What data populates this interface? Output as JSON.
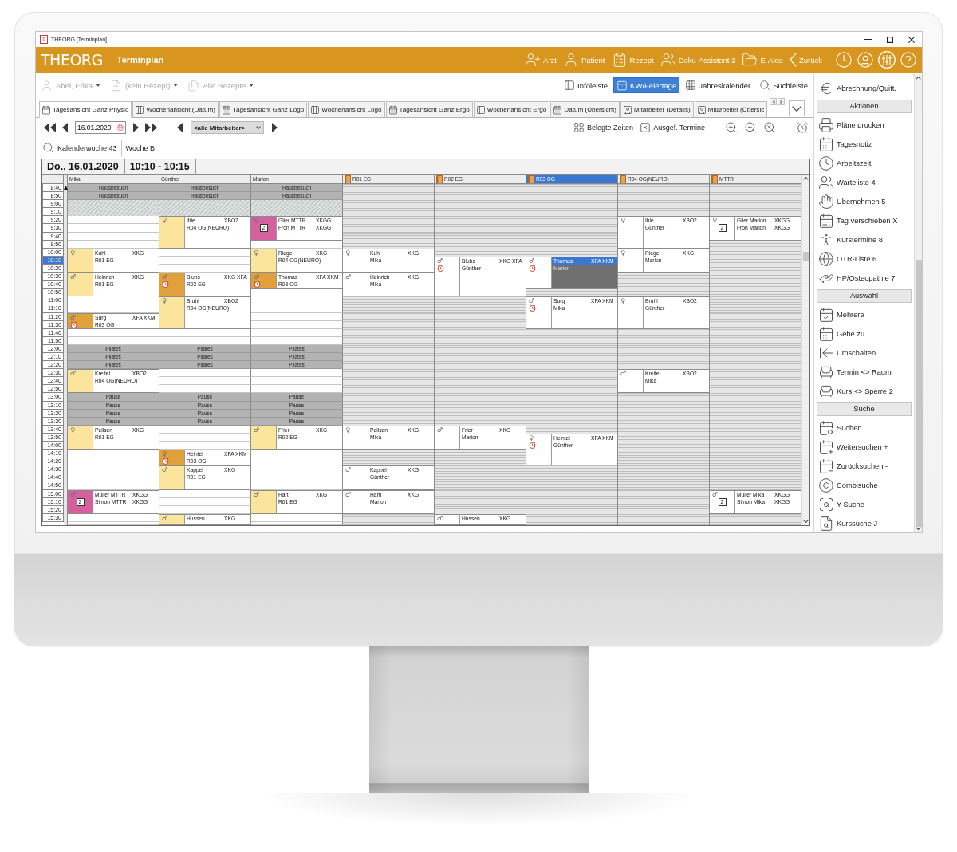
{
  "window": {
    "icon_letter": "T",
    "title": "THEORG [Terminplan]"
  },
  "header": {
    "logo": "THEORG",
    "title": "Terminplan",
    "nav": [
      {
        "label": "Arzt"
      },
      {
        "label": "Patient"
      },
      {
        "label": "Rezept"
      },
      {
        "label": "Doku-Assistent 3"
      },
      {
        "label": "E-Akte"
      },
      {
        "label": "Zurück"
      }
    ]
  },
  "toolbar": {
    "selectors": [
      {
        "label": "Abel, Erika",
        "disabled": true
      },
      {
        "label": "(kein Rezept)",
        "disabled": true
      },
      {
        "label": "Alle Rezepte",
        "disabled": true
      }
    ],
    "toggles": [
      {
        "label": "Infoleiste",
        "selected": false
      },
      {
        "label": "KW/Feiertage",
        "selected": true
      },
      {
        "label": "Jahreskalender",
        "selected": false
      },
      {
        "label": "Suchleiste",
        "selected": false
      }
    ]
  },
  "tabs": [
    {
      "label": "Tagesansicht Ganz Physio",
      "selected": true
    },
    {
      "label": "Wochenansicht (Datum)",
      "selected": false
    },
    {
      "label": "Tagesansicht Ganz Logo",
      "selected": false
    },
    {
      "label": "Wochenansicht Logo",
      "selected": false
    },
    {
      "label": "Tagesansicht Ganz Ergo",
      "selected": false
    },
    {
      "label": "Wochenansicht Ergo",
      "selected": false
    },
    {
      "label": "Datum (Übersicht)",
      "selected": false
    },
    {
      "label": "Mitarbeiter (Details)",
      "selected": false
    },
    {
      "label": "Mitarbeiter (Übersic",
      "selected": false
    }
  ],
  "navigation": {
    "date": "16.01.2020",
    "filter": "<alle Mitarbeiter>",
    "actions": [
      {
        "label": "Belegte Zeiten"
      },
      {
        "label": "Ausgef. Termine"
      }
    ]
  },
  "week_bar": {
    "week": "Kalenderwoche 43",
    "rotation": "Woche B"
  },
  "calendar": {
    "date": "Do., 16.01.2020",
    "time": "10:10 - 10:15",
    "time_slots": [
      {
        "label": "8:40",
        "selected": false
      },
      {
        "label": "8:50",
        "selected": false
      },
      {
        "label": "9:00",
        "selected": false
      },
      {
        "label": "9:10",
        "selected": false
      },
      {
        "label": "9:20",
        "selected": false
      },
      {
        "label": "9:30",
        "selected": false
      },
      {
        "label": "9:40",
        "selected": false
      },
      {
        "label": "9:50",
        "selected": false
      },
      {
        "label": "10:00",
        "selected": false
      },
      {
        "label": "10:10",
        "selected": true
      },
      {
        "label": "10:20",
        "selected": false
      },
      {
        "label": "10:30",
        "selected": false
      },
      {
        "label": "10:40",
        "selected": false
      },
      {
        "label": "10:50",
        "selected": false
      },
      {
        "label": "11:00",
        "selected": false
      },
      {
        "label": "11:10",
        "selected": false
      },
      {
        "label": "11:20",
        "selected": false
      },
      {
        "label": "11:30",
        "selected": false
      },
      {
        "label": "11:40",
        "selected": false
      },
      {
        "label": "11:50",
        "selected": false
      },
      {
        "label": "12:00",
        "selected": false
      },
      {
        "label": "12:10",
        "selected": false
      },
      {
        "label": "12:20",
        "selected": false
      },
      {
        "label": "12:30",
        "selected": false
      },
      {
        "label": "12:40",
        "selected": false
      },
      {
        "label": "12:50",
        "selected": false
      },
      {
        "label": "13:00",
        "selected": false
      },
      {
        "label": "13:10",
        "selected": false
      },
      {
        "label": "13:20",
        "selected": false
      },
      {
        "label": "13:30",
        "selected": false
      },
      {
        "label": "13:40",
        "selected": false
      },
      {
        "label": "13:50",
        "selected": false
      },
      {
        "label": "14:00",
        "selected": false
      },
      {
        "label": "14:10",
        "selected": false
      },
      {
        "label": "14:20",
        "selected": false
      },
      {
        "label": "14:30",
        "selected": false
      },
      {
        "label": "14:40",
        "selected": false
      },
      {
        "label": "14:50",
        "selected": false
      },
      {
        "label": "15:00",
        "selected": false
      },
      {
        "label": "15:10",
        "selected": false
      },
      {
        "label": "15:20",
        "selected": false
      },
      {
        "label": "15:30",
        "selected": false
      }
    ],
    "columns": [
      {
        "kind": "employee",
        "header": "Mika",
        "selected": false,
        "slots": [
          {
            "kind": "block",
            "label": "Hausbesuch"
          },
          {
            "kind": "block",
            "label": "Hausbesuch"
          },
          {
            "kind": "hatch"
          },
          {
            "kind": "hatch"
          },
          {
            "kind": "free"
          },
          {
            "kind": "free"
          },
          {
            "kind": "free"
          },
          {
            "kind": "free"
          },
          {
            "kind": "appointment",
            "symbol": "♀",
            "color": "#fbe49c",
            "clock": false,
            "selected": false,
            "lines": [
              {
                "name": "Kuhl",
                "code": "XKG"
              },
              {
                "name": "R01 EG"
              }
            ]
          },
          {
            "kind": "continued"
          },
          {
            "kind": "continued"
          },
          {
            "kind": "appointment",
            "symbol": "♂",
            "color": "#fbe49c",
            "clock": false,
            "selected": false,
            "lines": [
              {
                "name": "Heinrich",
                "code": "XKG"
              },
              {
                "name": "R01 EG"
              }
            ]
          },
          {
            "kind": "continued"
          },
          {
            "kind": "continued"
          },
          {
            "kind": "free"
          },
          {
            "kind": "free"
          },
          {
            "kind": "appointment",
            "symbol": "♂",
            "color": "#e0a03c",
            "clock": true,
            "selected": false,
            "lines": [
              {
                "name": "Surg",
                "code": "XFA XKM"
              },
              {
                "name": "R03 OG"
              }
            ]
          },
          {
            "kind": "continued"
          },
          {
            "kind": "free"
          },
          {
            "kind": "free"
          },
          {
            "kind": "block",
            "label": "Pilates"
          },
          {
            "kind": "block",
            "label": "Pilates"
          },
          {
            "kind": "block",
            "label": "Pilates"
          },
          {
            "kind": "appointment",
            "symbol": "♂",
            "color": "#fbe49c",
            "clock": false,
            "selected": false,
            "lines": [
              {
                "name": "Kreitel",
                "code": "XBO2"
              },
              {
                "name": "R04 OG(NEURO)"
              }
            ]
          },
          {
            "kind": "continued"
          },
          {
            "kind": "continued"
          },
          {
            "kind": "block",
            "label": "Pause"
          },
          {
            "kind": "block",
            "label": "Pause"
          },
          {
            "kind": "block",
            "label": "Pause"
          },
          {
            "kind": "block",
            "label": "Pause"
          },
          {
            "kind": "appointment",
            "symbol": "♀",
            "color": "#fbe49c",
            "clock": false,
            "selected": false,
            "lines": [
              {
                "name": "Peilsen",
                "code": "XKG"
              },
              {
                "name": "R01 EG"
              }
            ]
          },
          {
            "kind": "continued"
          },
          {
            "kind": "continued"
          },
          {
            "kind": "free"
          },
          {
            "kind": "free"
          },
          {
            "kind": "free"
          },
          {
            "kind": "free"
          },
          {
            "kind": "free"
          },
          {
            "kind": "appointment",
            "symbol": "♂",
            "color": "#d5609e",
            "clock": false,
            "count": "2",
            "selected": false,
            "lines": [
              {
                "name": "Müller MTTR",
                "code": "XKGG"
              },
              {
                "name": "Simon MTTR",
                "code": "XKGG"
              }
            ]
          },
          {
            "kind": "continued"
          },
          {
            "kind": "continued"
          },
          {
            "kind": "free"
          },
          {
            "kind": "free"
          }
        ]
      },
      {
        "kind": "employee",
        "header": "Günther",
        "selected": false,
        "slots": [
          {
            "kind": "block",
            "label": "Hausbesuch"
          },
          {
            "kind": "block",
            "label": "Hausbesuch"
          },
          {
            "kind": "hatch"
          },
          {
            "kind": "hatch"
          },
          {
            "kind": "appointment",
            "symbol": "♀",
            "color": "#fbe49c",
            "clock": false,
            "selected": false,
            "lines": [
              {
                "name": "Ihle",
                "code": "XBO2"
              },
              {
                "name": "R04 OG(NEURO)"
              }
            ]
          },
          {
            "kind": "continued"
          },
          {
            "kind": "continued"
          },
          {
            "kind": "continued"
          },
          {
            "kind": "free"
          },
          {
            "kind": "free"
          },
          {
            "kind": "free"
          },
          {
            "kind": "appointment",
            "symbol": "♂",
            "color": "#e0a03c",
            "clock": true,
            "selected": false,
            "lines": [
              {
                "name": "Bluhs",
                "code": "XKG XFA"
              },
              {
                "name": "R02 EG"
              }
            ]
          },
          {
            "kind": "continued"
          },
          {
            "kind": "continued"
          },
          {
            "kind": "appointment",
            "symbol": "♀",
            "color": "#fbe49c",
            "clock": false,
            "selected": false,
            "lines": [
              {
                "name": "Bruhl",
                "code": "XBO2"
              },
              {
                "name": "R04 OG(NEURO)"
              }
            ]
          },
          {
            "kind": "continued"
          },
          {
            "kind": "continued"
          },
          {
            "kind": "continued"
          },
          {
            "kind": "free"
          },
          {
            "kind": "free"
          },
          {
            "kind": "block",
            "label": "Pilates"
          },
          {
            "kind": "block",
            "label": "Pilates"
          },
          {
            "kind": "block",
            "label": "Pilates"
          },
          {
            "kind": "free"
          },
          {
            "kind": "free"
          },
          {
            "kind": "free"
          },
          {
            "kind": "block",
            "label": "Pause"
          },
          {
            "kind": "block",
            "label": "Pause"
          },
          {
            "kind": "block",
            "label": "Pause"
          },
          {
            "kind": "block",
            "label": "Pause"
          },
          {
            "kind": "free"
          },
          {
            "kind": "free"
          },
          {
            "kind": "free"
          },
          {
            "kind": "appointment",
            "symbol": "♀",
            "color": "#e0a03c",
            "clock": true,
            "selected": false,
            "lines": [
              {
                "name": "Heintel",
                "code": "XFA XKM"
              },
              {
                "name": "R03 OG"
              }
            ]
          },
          {
            "kind": "continued"
          },
          {
            "kind": "appointment",
            "symbol": "♂",
            "color": "#fbe49c",
            "clock": false,
            "selected": false,
            "lines": [
              {
                "name": "Kappel",
                "code": "XKG"
              },
              {
                "name": "R01 EG"
              }
            ]
          },
          {
            "kind": "continued"
          },
          {
            "kind": "continued"
          },
          {
            "kind": "free"
          },
          {
            "kind": "free"
          },
          {
            "kind": "free"
          },
          {
            "kind": "appointment",
            "symbol": "♂",
            "color": "#fbe49c",
            "clock": false,
            "selected": false,
            "lines": [
              {
                "name": "Hussen",
                "code": "XKG"
              }
            ]
          },
          {
            "kind": "continued"
          }
        ]
      },
      {
        "kind": "employee",
        "header": "Marion",
        "selected": false,
        "slots": [
          {
            "kind": "block",
            "label": "Hausbesuch"
          },
          {
            "kind": "block",
            "label": "Hausbesuch"
          },
          {
            "kind": "hatch"
          },
          {
            "kind": "hatch"
          },
          {
            "kind": "appointment",
            "symbol": "♀",
            "color": "#d5609e",
            "clock": false,
            "count": "2",
            "selected": false,
            "lines": [
              {
                "name": "Glier MTTR",
                "code": "XKGG"
              },
              {
                "name": "Froh MTTR",
                "code": "XKGG"
              }
            ]
          },
          {
            "kind": "continued"
          },
          {
            "kind": "continued"
          },
          {
            "kind": "free"
          },
          {
            "kind": "appointment",
            "symbol": "♀",
            "color": "#fbe49c",
            "clock": false,
            "selected": false,
            "lines": [
              {
                "name": "Riegel",
                "code": "XKG"
              },
              {
                "name": "R04 OG(NEURO)"
              }
            ]
          },
          {
            "kind": "continued"
          },
          {
            "kind": "continued"
          },
          {
            "kind": "appointment",
            "symbol": "♂",
            "color": "#e0a03c",
            "clock": true,
            "selected": false,
            "lines": [
              {
                "name": "Thomas",
                "code": "XFA XKM"
              },
              {
                "name": "R03 OG"
              }
            ]
          },
          {
            "kind": "continued"
          },
          {
            "kind": "free"
          },
          {
            "kind": "free"
          },
          {
            "kind": "free"
          },
          {
            "kind": "free"
          },
          {
            "kind": "free"
          },
          {
            "kind": "free"
          },
          {
            "kind": "free"
          },
          {
            "kind": "block",
            "label": "Pilates"
          },
          {
            "kind": "block",
            "label": "Pilates"
          },
          {
            "kind": "block",
            "label": "Pilates"
          },
          {
            "kind": "free"
          },
          {
            "kind": "free"
          },
          {
            "kind": "free"
          },
          {
            "kind": "block",
            "label": "Pause"
          },
          {
            "kind": "block",
            "label": "Pause"
          },
          {
            "kind": "block",
            "label": "Pause"
          },
          {
            "kind": "block",
            "label": "Pause"
          },
          {
            "kind": "appointment",
            "symbol": "♂",
            "color": "#fbe49c",
            "clock": false,
            "selected": false,
            "lines": [
              {
                "name": "Frier",
                "code": "XKG"
              },
              {
                "name": "R02 EG"
              }
            ]
          },
          {
            "kind": "continued"
          },
          {
            "kind": "continued"
          },
          {
            "kind": "free"
          },
          {
            "kind": "free"
          },
          {
            "kind": "free"
          },
          {
            "kind": "free"
          },
          {
            "kind": "free"
          },
          {
            "kind": "appointment",
            "symbol": "♂",
            "color": "#fbe49c",
            "clock": false,
            "selected": false,
            "lines": [
              {
                "name": "Hartl",
                "code": "XKG"
              },
              {
                "name": "R01 EG"
              }
            ]
          },
          {
            "kind": "continued"
          },
          {
            "kind": "continued"
          },
          {
            "kind": "free"
          },
          {
            "kind": "free"
          }
        ]
      },
      {
        "kind": "room",
        "header": "R01 EG",
        "selected": false,
        "slots": [
          {
            "kind": "free"
          },
          {
            "kind": "free"
          },
          {
            "kind": "free"
          },
          {
            "kind": "free"
          },
          {
            "kind": "free"
          },
          {
            "kind": "free"
          },
          {
            "kind": "free"
          },
          {
            "kind": "free"
          },
          {
            "kind": "appointment",
            "symbol": "♀",
            "clock": false,
            "selected": false,
            "lines": [
              {
                "name": "Kuhl",
                "code": "XKG"
              },
              {
                "name": "Mika"
              }
            ]
          },
          {
            "kind": "continued"
          },
          {
            "kind": "continued"
          },
          {
            "kind": "appointment",
            "symbol": "♂",
            "clock": false,
            "selected": false,
            "lines": [
              {
                "name": "Heinrich",
                "code": "XKG"
              },
              {
                "name": "Mika"
              }
            ]
          },
          {
            "kind": "continued"
          },
          {
            "kind": "continued"
          },
          {
            "kind": "free"
          },
          {
            "kind": "free"
          },
          {
            "kind": "free"
          },
          {
            "kind": "free"
          },
          {
            "kind": "free"
          },
          {
            "kind": "free"
          },
          {
            "kind": "free"
          },
          {
            "kind": "free"
          },
          {
            "kind": "free"
          },
          {
            "kind": "free"
          },
          {
            "kind": "free"
          },
          {
            "kind": "free"
          },
          {
            "kind": "free"
          },
          {
            "kind": "free"
          },
          {
            "kind": "free"
          },
          {
            "kind": "free"
          },
          {
            "kind": "appointment",
            "symbol": "♀",
            "clock": false,
            "selected": false,
            "lines": [
              {
                "name": "Peilsen",
                "code": "XKG"
              },
              {
                "name": "Mika"
              }
            ]
          },
          {
            "kind": "continued"
          },
          {
            "kind": "continued"
          },
          {
            "kind": "free"
          },
          {
            "kind": "free"
          },
          {
            "kind": "appointment",
            "symbol": "♂",
            "clock": false,
            "selected": false,
            "lines": [
              {
                "name": "Kappel",
                "code": "XKG"
              },
              {
                "name": "Günther"
              }
            ]
          },
          {
            "kind": "continued"
          },
          {
            "kind": "continued"
          },
          {
            "kind": "appointment",
            "symbol": "♂",
            "clock": false,
            "selected": false,
            "lines": [
              {
                "name": "Hartl",
                "code": "XKG"
              },
              {
                "name": "Marion"
              }
            ]
          },
          {
            "kind": "continued"
          },
          {
            "kind": "continued"
          },
          {
            "kind": "free"
          },
          {
            "kind": "free"
          }
        ]
      },
      {
        "kind": "room",
        "header": "R02 EG",
        "selected": false,
        "slots": [
          {
            "kind": "free"
          },
          {
            "kind": "free"
          },
          {
            "kind": "free"
          },
          {
            "kind": "free"
          },
          {
            "kind": "free"
          },
          {
            "kind": "free"
          },
          {
            "kind": "free"
          },
          {
            "kind": "free"
          },
          {
            "kind": "free"
          },
          {
            "kind": "appointment",
            "symbol": "♂",
            "clock": true,
            "selected": false,
            "lines": [
              {
                "name": "Bluhs",
                "code": "XKG XFA"
              },
              {
                "name": "Günther"
              }
            ]
          },
          {
            "kind": "continued"
          },
          {
            "kind": "continued"
          },
          {
            "kind": "continued"
          },
          {
            "kind": "continued"
          },
          {
            "kind": "free"
          },
          {
            "kind": "free"
          },
          {
            "kind": "free"
          },
          {
            "kind": "free"
          },
          {
            "kind": "free"
          },
          {
            "kind": "free"
          },
          {
            "kind": "free"
          },
          {
            "kind": "free"
          },
          {
            "kind": "free"
          },
          {
            "kind": "free"
          },
          {
            "kind": "free"
          },
          {
            "kind": "free"
          },
          {
            "kind": "free"
          },
          {
            "kind": "free"
          },
          {
            "kind": "free"
          },
          {
            "kind": "free"
          },
          {
            "kind": "appointment",
            "symbol": "♂",
            "clock": false,
            "selected": false,
            "lines": [
              {
                "name": "Frier",
                "code": "XKG"
              },
              {
                "name": "Marion"
              }
            ]
          },
          {
            "kind": "continued"
          },
          {
            "kind": "continued"
          },
          {
            "kind": "free"
          },
          {
            "kind": "free"
          },
          {
            "kind": "free"
          },
          {
            "kind": "free"
          },
          {
            "kind": "free"
          },
          {
            "kind": "free"
          },
          {
            "kind": "free"
          },
          {
            "kind": "free"
          },
          {
            "kind": "appointment",
            "symbol": "♂",
            "clock": false,
            "selected": false,
            "lines": [
              {
                "name": "Hussen",
                "code": "XKG"
              }
            ]
          },
          {
            "kind": "continued"
          }
        ]
      },
      {
        "kind": "room",
        "header": "R03 OG",
        "selected": true,
        "slots": [
          {
            "kind": "free"
          },
          {
            "kind": "free"
          },
          {
            "kind": "free"
          },
          {
            "kind": "free"
          },
          {
            "kind": "free"
          },
          {
            "kind": "free"
          },
          {
            "kind": "free"
          },
          {
            "kind": "free"
          },
          {
            "kind": "free"
          },
          {
            "kind": "appointment",
            "symbol": "♂",
            "clock": true,
            "selected": true,
            "lines": [
              {
                "name": "Thomas",
                "code": "XFA XKM"
              },
              {
                "name": "Marion"
              }
            ]
          },
          {
            "kind": "continued"
          },
          {
            "kind": "continued"
          },
          {
            "kind": "continued"
          },
          {
            "kind": "free"
          },
          {
            "kind": "appointment",
            "symbol": "♂",
            "clock": true,
            "selected": false,
            "lines": [
              {
                "name": "Surg",
                "code": "XFA XKM"
              },
              {
                "name": "Mika"
              }
            ]
          },
          {
            "kind": "continued"
          },
          {
            "kind": "continued"
          },
          {
            "kind": "continued"
          },
          {
            "kind": "free"
          },
          {
            "kind": "free"
          },
          {
            "kind": "free"
          },
          {
            "kind": "free"
          },
          {
            "kind": "free"
          },
          {
            "kind": "free"
          },
          {
            "kind": "free"
          },
          {
            "kind": "free"
          },
          {
            "kind": "free"
          },
          {
            "kind": "free"
          },
          {
            "kind": "free"
          },
          {
            "kind": "free"
          },
          {
            "kind": "free"
          },
          {
            "kind": "appointment",
            "symbol": "♀",
            "clock": true,
            "selected": false,
            "lines": [
              {
                "name": "Heintel",
                "code": "XFA XKM"
              },
              {
                "name": "Günther"
              }
            ]
          },
          {
            "kind": "continued"
          },
          {
            "kind": "continued"
          },
          {
            "kind": "continued"
          },
          {
            "kind": "free"
          },
          {
            "kind": "free"
          },
          {
            "kind": "free"
          },
          {
            "kind": "free"
          },
          {
            "kind": "free"
          },
          {
            "kind": "free"
          },
          {
            "kind": "free"
          },
          {
            "kind": "free"
          }
        ]
      },
      {
        "kind": "room",
        "header": "R04 OG(NEURO)",
        "selected": false,
        "slots": [
          {
            "kind": "free"
          },
          {
            "kind": "free"
          },
          {
            "kind": "free"
          },
          {
            "kind": "free"
          },
          {
            "kind": "appointment",
            "symbol": "♀",
            "clock": false,
            "selected": false,
            "lines": [
              {
                "name": "Ihle",
                "code": "XBO2"
              },
              {
                "name": "Günther"
              }
            ]
          },
          {
            "kind": "continued"
          },
          {
            "kind": "continued"
          },
          {
            "kind": "continued"
          },
          {
            "kind": "appointment",
            "symbol": "♀",
            "clock": false,
            "selected": false,
            "lines": [
              {
                "name": "Riegel",
                "code": "XKG"
              },
              {
                "name": "Marion"
              }
            ]
          },
          {
            "kind": "continued"
          },
          {
            "kind": "continued"
          },
          {
            "kind": "free"
          },
          {
            "kind": "free"
          },
          {
            "kind": "free"
          },
          {
            "kind": "appointment",
            "symbol": "♀",
            "clock": false,
            "selected": false,
            "lines": [
              {
                "name": "Bruhl",
                "code": "XBO2"
              },
              {
                "name": "Günther"
              }
            ]
          },
          {
            "kind": "continued"
          },
          {
            "kind": "continued"
          },
          {
            "kind": "continued"
          },
          {
            "kind": "free"
          },
          {
            "kind": "free"
          },
          {
            "kind": "free"
          },
          {
            "kind": "free"
          },
          {
            "kind": "free"
          },
          {
            "kind": "appointment",
            "symbol": "♂",
            "clock": false,
            "selected": false,
            "lines": [
              {
                "name": "Kreitel",
                "code": "XBO2"
              },
              {
                "name": "Mika"
              }
            ]
          },
          {
            "kind": "continued"
          },
          {
            "kind": "continued"
          },
          {
            "kind": "free"
          },
          {
            "kind": "free"
          },
          {
            "kind": "free"
          },
          {
            "kind": "free"
          },
          {
            "kind": "free"
          },
          {
            "kind": "free"
          },
          {
            "kind": "free"
          },
          {
            "kind": "free"
          },
          {
            "kind": "free"
          },
          {
            "kind": "free"
          },
          {
            "kind": "free"
          },
          {
            "kind": "free"
          },
          {
            "kind": "free"
          },
          {
            "kind": "free"
          },
          {
            "kind": "free"
          },
          {
            "kind": "free"
          },
          {
            "kind": "free"
          }
        ]
      },
      {
        "kind": "room",
        "header": "MTTR",
        "selected": false,
        "slots": [
          {
            "kind": "free"
          },
          {
            "kind": "free"
          },
          {
            "kind": "free"
          },
          {
            "kind": "free"
          },
          {
            "kind": "appointment",
            "symbol": "♀",
            "clock": false,
            "count": "2",
            "selected": false,
            "lines": [
              {
                "name": "Glier Marion",
                "code": "XKGG"
              },
              {
                "name": "Froh Marion",
                "code": "XKGG"
              }
            ]
          },
          {
            "kind": "continued"
          },
          {
            "kind": "continued"
          },
          {
            "kind": "free"
          },
          {
            "kind": "free"
          },
          {
            "kind": "free"
          },
          {
            "kind": "free"
          },
          {
            "kind": "free"
          },
          {
            "kind": "free"
          },
          {
            "kind": "free"
          },
          {
            "kind": "free"
          },
          {
            "kind": "free"
          },
          {
            "kind": "free"
          },
          {
            "kind": "free"
          },
          {
            "kind": "free"
          },
          {
            "kind": "free"
          },
          {
            "kind": "free"
          },
          {
            "kind": "free"
          },
          {
            "kind": "free"
          },
          {
            "kind": "free"
          },
          {
            "kind": "free"
          },
          {
            "kind": "free"
          },
          {
            "kind": "free"
          },
          {
            "kind": "free"
          },
          {
            "kind": "free"
          },
          {
            "kind": "free"
          },
          {
            "kind": "free"
          },
          {
            "kind": "free"
          },
          {
            "kind": "free"
          },
          {
            "kind": "free"
          },
          {
            "kind": "free"
          },
          {
            "kind": "free"
          },
          {
            "kind": "free"
          },
          {
            "kind": "free"
          },
          {
            "kind": "appointment",
            "symbol": "♂",
            "clock": false,
            "count": "2",
            "selected": false,
            "lines": [
              {
                "name": "Müller Mika",
                "code": "XKGG"
              },
              {
                "name": "Simon Mika",
                "code": "XKGG"
              }
            ]
          },
          {
            "kind": "continued"
          },
          {
            "kind": "continued"
          },
          {
            "kind": "free"
          },
          {
            "kind": "free"
          }
        ]
      }
    ]
  },
  "sidebar": {
    "items": [
      {
        "kind": "item",
        "label": "Abrechnung/Quitt."
      },
      {
        "kind": "header",
        "label": "Aktionen"
      },
      {
        "kind": "item",
        "label": "Pläne drucken"
      },
      {
        "kind": "item",
        "label": "Tagesnotiz"
      },
      {
        "kind": "item",
        "label": "Arbeitszeit"
      },
      {
        "kind": "item",
        "label": "Warteliste 4"
      },
      {
        "kind": "item",
        "label": "Übernehmen 5"
      },
      {
        "kind": "item",
        "label": "Tag verschieben X"
      },
      {
        "kind": "item",
        "label": "Kurstermine 8"
      },
      {
        "kind": "item",
        "label": "OTR-Liste 6"
      },
      {
        "kind": "item",
        "label": "HP/Osteopathie 7"
      },
      {
        "kind": "header",
        "label": "Auswahl"
      },
      {
        "kind": "item",
        "label": "Mehrere"
      },
      {
        "kind": "item",
        "label": "Gehe zu"
      },
      {
        "kind": "item",
        "label": "Umschalten"
      },
      {
        "kind": "item",
        "label": "Termin <> Raum"
      },
      {
        "kind": "item",
        "label": "Kurs <> Sperre 2"
      },
      {
        "kind": "header",
        "label": "Suche"
      },
      {
        "kind": "item",
        "label": "Suchen"
      },
      {
        "kind": "item",
        "label": "Weitersuchen +"
      },
      {
        "kind": "item",
        "label": "Zurücksuchen -"
      },
      {
        "kind": "item",
        "label": "Combisuche"
      },
      {
        "kind": "item",
        "label": "Y-Suche"
      },
      {
        "kind": "item",
        "label": "Kurssuche J"
      }
    ]
  }
}
